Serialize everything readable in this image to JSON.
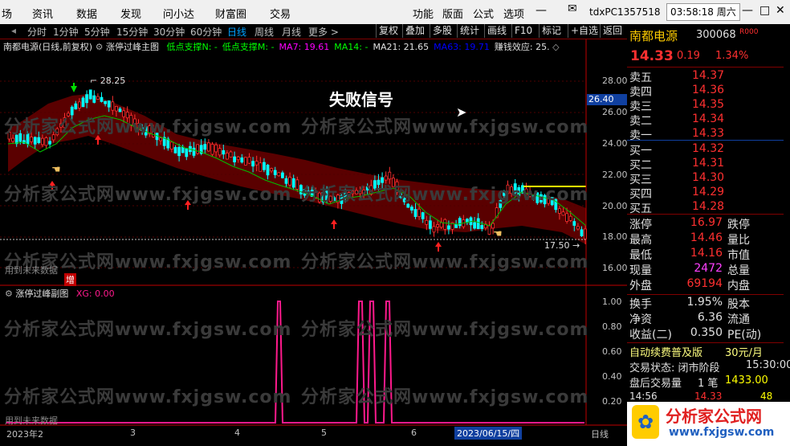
{
  "menubar": {
    "left_items": [
      "场",
      "资讯",
      "数据",
      "发现",
      "问小达",
      "财富圈",
      "交易"
    ],
    "right_items": [
      "功能",
      "版面",
      "公式",
      "选项"
    ],
    "account": "tdxPC1357518",
    "time": "03:58:18 周六"
  },
  "toolbar": {
    "periods": [
      "分时",
      "1分钟",
      "5分钟",
      "15分钟",
      "30分钟",
      "60分钟",
      "日线",
      "周线",
      "月线",
      "更多 >"
    ],
    "active_period": "日线",
    "right_buttons": [
      "复权",
      "叠加",
      "多股",
      "统计",
      "画线",
      "F10",
      "标记",
      "+自选",
      "返回"
    ]
  },
  "main_chart": {
    "title": "南都电源(日线,前复权)",
    "indicator_name": "涨停过峰主图",
    "legend": [
      {
        "text": "低点支撑N: -",
        "color": "#00ff00"
      },
      {
        "text": "低点支撑M: -",
        "color": "#00ff00"
      },
      {
        "text": "MA7: 19.61",
        "color": "#ff00ff"
      },
      {
        "text": "MA14: -",
        "color": "#00ff00"
      },
      {
        "text": "MA21: 21.65",
        "color": "#e0e0e0"
      },
      {
        "text": "MA63: 19.71",
        "color": "#0000ff"
      },
      {
        "text": "赚钱效应: 25.",
        "color": "#e0e0e0"
      }
    ],
    "signal_text": "失败信号",
    "high_label": "28.25",
    "low_label": "17.50",
    "current_price_tag": "26.40",
    "future_data_label": "用到未来数据",
    "zeng_label": "增",
    "price_ticks": [
      "28.00",
      "26.00",
      "24.00",
      "22.00",
      "20.00",
      "18.00",
      "16.00"
    ]
  },
  "sub_chart": {
    "indicator_name": "涨停过峰副图",
    "xg_label": "XG: 0.00",
    "ticks": [
      "1.00",
      "0.80",
      "0.60",
      "0.40",
      "0.20"
    ],
    "future_data_label": "用到未来数据"
  },
  "x_axis": {
    "labels": [
      "2023年2",
      "3",
      "4",
      "5",
      "6"
    ],
    "cursor_date": "2023/06/15/四",
    "period_label": "日线"
  },
  "watermark": "分析家公式网www.fxjgsw.com",
  "logo": {
    "title": "分析家公式网",
    "url": "www.fxjgsw.com"
  },
  "quote_panel": {
    "name": "南都电源",
    "code": "300068",
    "rfund_tag": "R000",
    "price": "14.33",
    "change": "0.19",
    "change_pct": "1.34%",
    "asks": [
      {
        "label": "卖五",
        "price": "14.37"
      },
      {
        "label": "卖四",
        "price": "14.36"
      },
      {
        "label": "卖三",
        "price": "14.35"
      },
      {
        "label": "卖二",
        "price": "14.34"
      },
      {
        "label": "卖一",
        "price": "14.33"
      }
    ],
    "bids": [
      {
        "label": "买一",
        "price": "14.32"
      },
      {
        "label": "买二",
        "price": "14.31"
      },
      {
        "label": "买三",
        "price": "14.30"
      },
      {
        "label": "买四",
        "price": "14.29"
      },
      {
        "label": "买五",
        "price": "14.28"
      }
    ],
    "stats": [
      {
        "label": "涨停",
        "value": "16.97",
        "label2": "跌停"
      },
      {
        "label": "最高",
        "value": "14.46",
        "label2": "量比"
      },
      {
        "label": "最低",
        "value": "14.16",
        "label2": "市值"
      },
      {
        "label": "现量",
        "value": "2472",
        "label2": "总量"
      },
      {
        "label": "外盘",
        "value": "69194",
        "label2": "内盘"
      }
    ],
    "stats2": [
      {
        "label": "换手",
        "value": "1.95%",
        "label2": "股本"
      },
      {
        "label": "净资",
        "value": "6.36",
        "label2": "流通"
      },
      {
        "label": "收益(二)",
        "value": "0.350",
        "label2": "PE(动)"
      }
    ],
    "promo": "自动续费普及版",
    "promo_price": "30元/月",
    "trade_status": "交易状态: 闭市阶段",
    "trade_time": "15:30:00",
    "after_volume_label": "盘后交易量",
    "after_volume_count": "1 笔",
    "after_volume_value": "1433.00",
    "last_tick_time": "14:56",
    "last_tick_price": "14.33",
    "last_tick_vol": "48"
  },
  "colors": {
    "up": "#ff3030",
    "down": "#00ffff",
    "band": "#5a0000",
    "bg": "#000000"
  }
}
